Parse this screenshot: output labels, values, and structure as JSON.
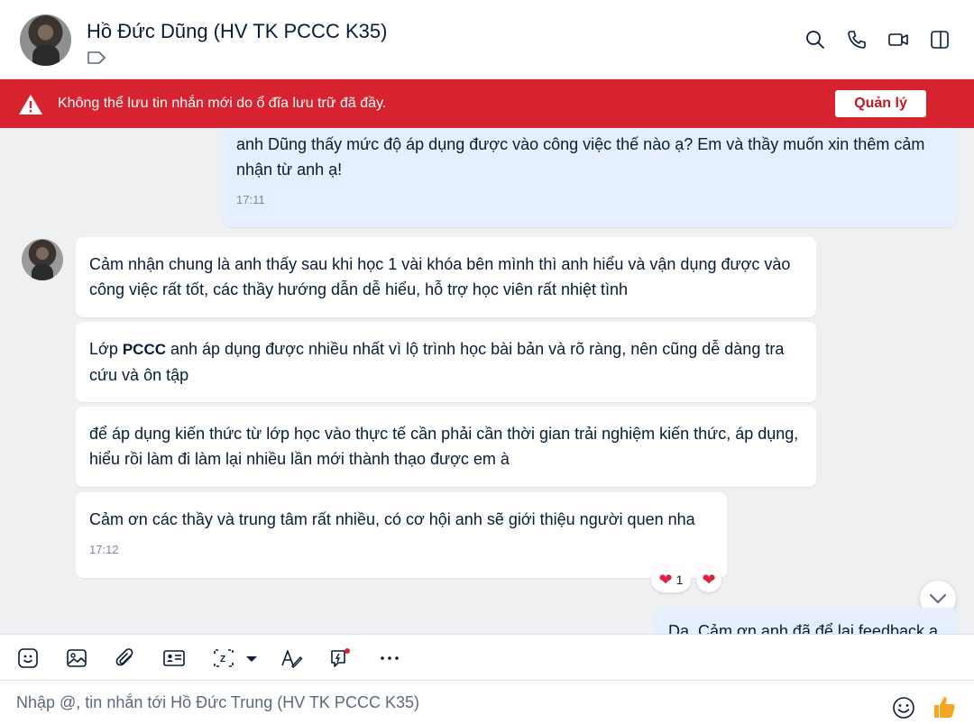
{
  "header": {
    "contact_name": "Hồ Đức Dũng (HV TK PCCC K35)",
    "icons": [
      "avatar",
      "label-tag-icon",
      "search-icon",
      "phone-icon",
      "video-call-icon",
      "sidebar-toggle-icon"
    ]
  },
  "banner": {
    "message": "Không thể lưu tin nhắn mới do ổ đĩa lưu trữ đã đầy.",
    "button_label": "Quản lý",
    "color": "#d7222f",
    "icon": "warning-icon"
  },
  "messages": {
    "top_sent": {
      "text": "anh Dũng thấy mức độ áp dụng được vào công việc thế nào ạ? Em và thầy muốn xin thêm cảm nhận từ anh ạ!",
      "time": "17:11"
    },
    "received": [
      {
        "text": "Cảm nhận chung là anh thấy sau khi học 1 vài khóa bên mình thì anh hiểu và vận dụng được vào công việc rất tốt, các thầy hướng dẫn dễ hiểu, hỗ trợ học viên rất nhiệt tình"
      },
      {
        "text_before": "Lớp ",
        "text_bold": "PCCC",
        "text_after": " anh áp dụng được nhiều nhất vì lộ trình học bài bản và rõ ràng, nên cũng dễ dàng tra cứu và ôn tập"
      },
      {
        "text": "để áp dụng kiến thức từ lớp học vào thực tế cần phải cần thời gian trải nghiệm kiến thức, áp dụng, hiểu rồi làm đi làm lại nhiều lần mới thành thạo được em à"
      },
      {
        "text": "Cảm ơn các thầy và trung tâm rất nhiều, có cơ hội anh sẽ giới thiệu người quen nha",
        "time": "17:12"
      }
    ],
    "reaction": {
      "emoji": "❤",
      "count": "1",
      "color": "#e0203b"
    },
    "bottom_sent": {
      "text": "Dạ, Cảm ơn anh đã để lại feedback ạ"
    }
  },
  "toolbar": {
    "icons": [
      "sticker-icon",
      "image-icon",
      "attachment-icon",
      "contact-card-icon",
      "screenshot-icon",
      "dropdown-arrow-icon",
      "text-format-icon",
      "quick-message-icon",
      "more-icon"
    ]
  },
  "composer": {
    "placeholder": "Nhập @, tin nhắn tới Hồ Đức Trung (HV TK PCCC K35)",
    "value": ""
  },
  "colors": {
    "sent_bubble": "#e5efff",
    "received_bubble": "#ffffff",
    "chat_background": "#eef0f1",
    "like_color": "#f5a623"
  }
}
